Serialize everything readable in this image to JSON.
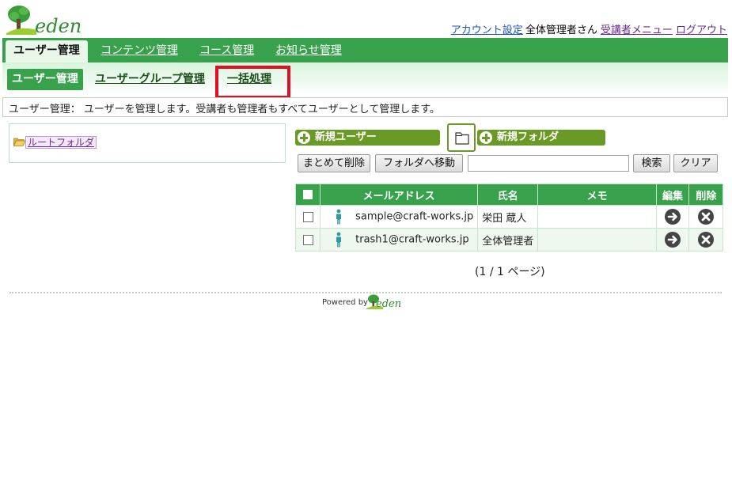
{
  "header": {
    "logo_text": "eden",
    "nav": {
      "account_settings": "アカウント設定",
      "user_greeting": "全体管理者さん",
      "student_menu": "受講者メニュー",
      "logout": "ログアウト"
    }
  },
  "main_tabs": [
    "ユーザー管理",
    "コンテンツ管理",
    "コース管理",
    "お知らせ管理"
  ],
  "sub_tabs": [
    "ユーザー管理",
    "ユーザーグループ管理",
    "一括処理"
  ],
  "description": "ユーザー管理： ユーザーを管理します。受講者も管理者もすべてユーザーとして管理します。",
  "tree": {
    "root_folder": "ルートフォルダ"
  },
  "actions": {
    "new_user": "新規ユーザー",
    "new_folder": "新規フォルダ",
    "bulk_delete": "まとめて削除",
    "move_to_folder": "フォルダへ移動",
    "search_value": "",
    "search": "検索",
    "clear": "クリア"
  },
  "table": {
    "headers": {
      "email": "メールアドレス",
      "name": "氏名",
      "memo": "メモ",
      "edit": "編集",
      "delete": "削除"
    },
    "rows": [
      {
        "email": "sample@craft-works.jp",
        "name": "栄田 蔵人",
        "memo": ""
      },
      {
        "email": "trash1@craft-works.jp",
        "name": "全体管理者",
        "memo": ""
      }
    ]
  },
  "pagination": "(1 / 1 ページ)",
  "footer": {
    "powered_by": "Powered by",
    "logo_text": "eden"
  },
  "colors": {
    "primary_green": "#37a24b",
    "action_green": "#6a9a26",
    "highlight_red": "#e01020"
  }
}
